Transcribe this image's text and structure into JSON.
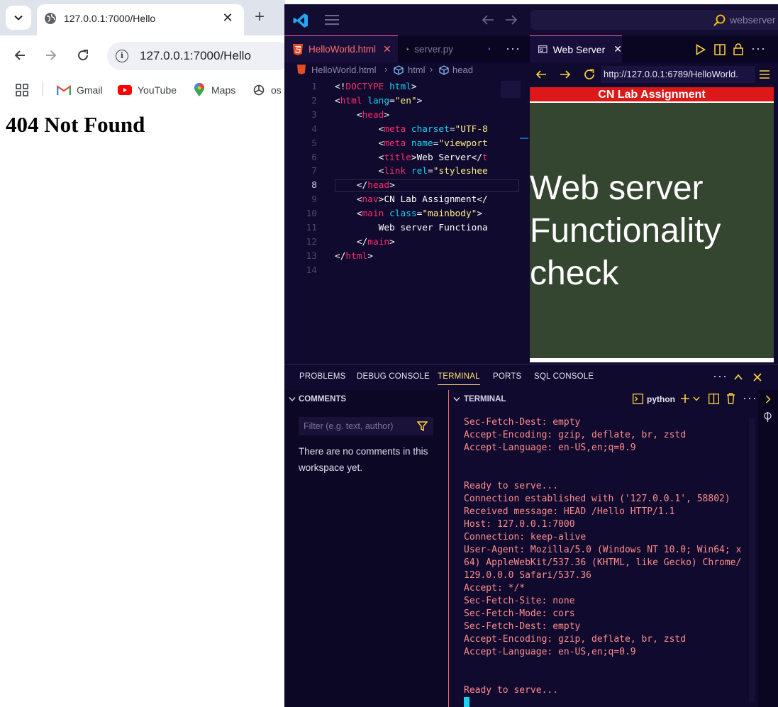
{
  "chrome": {
    "tab_title": "127.0.0.1:7000/Hello",
    "url": "127.0.0.1:7000/Hello",
    "bookmarks": [
      "Gmail",
      "YouTube",
      "Maps",
      "os"
    ],
    "page_heading": "404 Not Found"
  },
  "vscode": {
    "command_center": "webserver",
    "editor_tabs": [
      "HelloWorld.html",
      "server.py"
    ],
    "breadcrumb": [
      "HelloWorld.html",
      "html",
      "head"
    ],
    "line_numbers": [
      "1",
      "2",
      "3",
      "4",
      "5",
      "6",
      "7",
      "8",
      "9",
      "10",
      "11",
      "12",
      "13",
      "14"
    ],
    "code_lines": [
      [
        [
          "p",
          "<!"
        ],
        [
          "t",
          "DOCTYPE"
        ],
        [
          "p",
          " "
        ],
        [
          "a",
          "html"
        ],
        [
          "p",
          ">"
        ]
      ],
      [
        [
          "p",
          "<"
        ],
        [
          "t",
          "html"
        ],
        [
          "p",
          " "
        ],
        [
          "a",
          "lang"
        ],
        [
          "p",
          "="
        ],
        [
          "s",
          "\"en\""
        ],
        [
          "p",
          ">"
        ]
      ],
      [
        [
          "p",
          "    <"
        ],
        [
          "t",
          "head"
        ],
        [
          "p",
          ">"
        ]
      ],
      [
        [
          "p",
          "        <"
        ],
        [
          "t",
          "meta"
        ],
        [
          "p",
          " "
        ],
        [
          "a",
          "charset"
        ],
        [
          "p",
          "="
        ],
        [
          "s",
          "\"UTF-8"
        ]
      ],
      [
        [
          "p",
          "        <"
        ],
        [
          "t",
          "meta"
        ],
        [
          "p",
          " "
        ],
        [
          "a",
          "name"
        ],
        [
          "p",
          "="
        ],
        [
          "s",
          "\"viewport"
        ]
      ],
      [
        [
          "p",
          "        <"
        ],
        [
          "t",
          "title"
        ],
        [
          "p",
          ">Web Server</"
        ],
        [
          "t",
          "t"
        ]
      ],
      [
        [
          "p",
          "        <"
        ],
        [
          "t",
          "link"
        ],
        [
          "p",
          " "
        ],
        [
          "a",
          "rel"
        ],
        [
          "p",
          "="
        ],
        [
          "s",
          "\"styleshee"
        ]
      ],
      [
        [
          "p",
          "    </"
        ],
        [
          "t",
          "head"
        ],
        [
          "p",
          ">"
        ]
      ],
      [
        [
          "p",
          "    <"
        ],
        [
          "t",
          "nav"
        ],
        [
          "p",
          ">CN Lab Assignment</"
        ]
      ],
      [
        [
          "p",
          "    <"
        ],
        [
          "t",
          "main"
        ],
        [
          "p",
          " "
        ],
        [
          "a",
          "class"
        ],
        [
          "p",
          "="
        ],
        [
          "s",
          "\"mainbody\""
        ],
        [
          "p",
          ">"
        ]
      ],
      [
        [
          "p",
          "        Web server Functiona"
        ]
      ],
      [
        [
          "p",
          "    </"
        ],
        [
          "t",
          "main"
        ],
        [
          "p",
          ">"
        ]
      ],
      [
        [
          "p",
          "</"
        ],
        [
          "t",
          "html"
        ],
        [
          "p",
          ">"
        ]
      ],
      [
        [
          "p",
          ""
        ]
      ]
    ],
    "preview": {
      "tab_title": "Web Server",
      "url": "http://127.0.0.1:6789/HelloWorld.",
      "nav_text": "CN Lab Assignment",
      "main_text": "Web server Functionality check"
    },
    "panel": {
      "tabs": [
        "PROBLEMS",
        "DEBUG CONSOLE",
        "TERMINAL",
        "PORTS",
        "SQL CONSOLE"
      ],
      "comments_header": "COMMENTS",
      "filter_placeholder": "Filter (e.g. text, author)",
      "no_comments": "There are no comments in this workspace yet.",
      "terminal_header": "TERMINAL",
      "terminal_shell": "python",
      "terminal_lines": [
        "Sec-Fetch-Dest: empty",
        "Accept-Encoding: gzip, deflate, br, zstd",
        "Accept-Language: en-US,en;q=0.9",
        "",
        "",
        "Ready to serve...",
        "Connection established with ('127.0.0.1', 58802)",
        "Received message: HEAD /Hello HTTP/1.1",
        "Host: 127.0.0.1:7000",
        "Connection: keep-alive",
        "User-Agent: Mozilla/5.0 (Windows NT 10.0; Win64; x",
        "64) AppleWebKit/537.36 (KHTML, like Gecko) Chrome/",
        "129.0.0.0 Safari/537.36",
        "Accept: */*",
        "Sec-Fetch-Site: none",
        "Sec-Fetch-Mode: cors",
        "Sec-Fetch-Dest: empty",
        "Accept-Encoding: gzip, deflate, br, zstd",
        "Accept-Language: en-US,en;q=0.9",
        "",
        "",
        "Ready to serve..."
      ]
    }
  },
  "colors": {
    "vscode_bg": "#0f0a2e",
    "terminal_text": "#ff8c8c",
    "preview_nav": "#dc1818",
    "preview_body": "#344530",
    "tag": "#ff2c6d",
    "attr": "#19d3f2",
    "string": "#ffee80"
  }
}
